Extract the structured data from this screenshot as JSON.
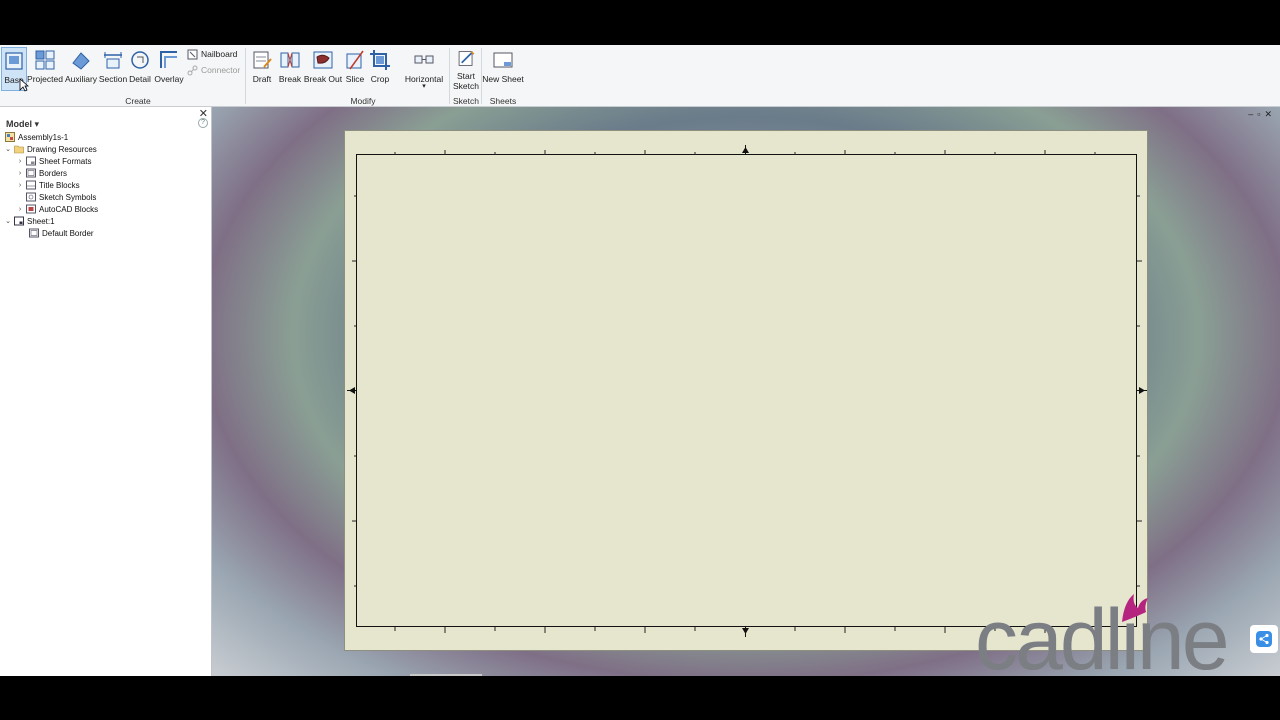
{
  "ribbon": {
    "create": {
      "label": "Create",
      "buttons": [
        "Base",
        "Projected",
        "Auxiliary",
        "Section",
        "Detail",
        "Overlay"
      ],
      "small": {
        "nailboard": "Nailboard",
        "connector": "Connector"
      }
    },
    "modify": {
      "label": "Modify",
      "buttons": [
        "Draft",
        "Break",
        "Break Out",
        "Slice",
        "Crop",
        "Horizontal"
      ]
    },
    "sketch": {
      "label": "Sketch",
      "button_line1": "Start",
      "button_line2": "Sketch"
    },
    "sheets": {
      "label": "Sheets",
      "button": "New Sheet"
    }
  },
  "browser": {
    "header": "Model",
    "close": "✕",
    "help": "?",
    "tree": [
      {
        "label": "Assembly1s-1",
        "level": 0,
        "expander": "",
        "icon": "assembly-icon"
      },
      {
        "label": "Drawing Resources",
        "level": 1,
        "expander": "⌄",
        "icon": "folder-icon"
      },
      {
        "label": "Sheet Formats",
        "level": 2,
        "expander": "›",
        "icon": "sheet-format-icon"
      },
      {
        "label": "Borders",
        "level": 2,
        "expander": "›",
        "icon": "border-icon"
      },
      {
        "label": "Title Blocks",
        "level": 2,
        "expander": "›",
        "icon": "title-block-icon"
      },
      {
        "label": "Sketch Symbols",
        "level": 2,
        "expander": "",
        "icon": "sketch-symbol-icon"
      },
      {
        "label": "AutoCAD Blocks",
        "level": 2,
        "expander": "›",
        "icon": "autocad-block-icon"
      },
      {
        "label": "Sheet:1",
        "level": 1,
        "expander": "⌄",
        "icon": "sheet-icon"
      },
      {
        "label": "Default Border",
        "level": 2,
        "expander": "",
        "icon": "default-border-icon"
      }
    ]
  },
  "canvas": {
    "window_controls": "–▫✕"
  },
  "logo": {
    "text": "cadline"
  },
  "colors": {
    "ribbon_bg": "#f5f6f7",
    "sheet_bg": "#e6e6cf",
    "active_btn": "#cfe3f7",
    "logo_gray": "#7b7e83",
    "logo_accent": "#b5247e"
  }
}
